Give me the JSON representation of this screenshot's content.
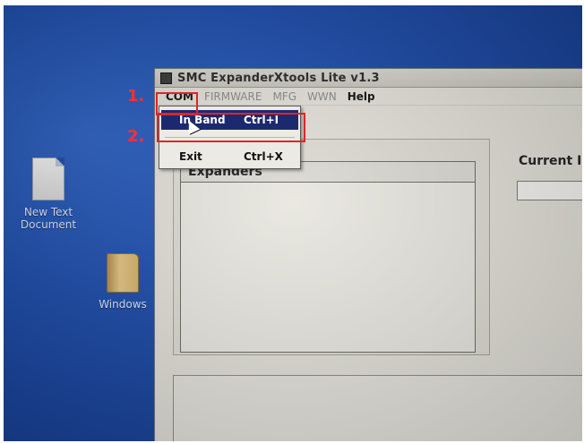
{
  "window": {
    "title": "SMC ExpanderXtools Lite v1.3"
  },
  "menu": [
    {
      "label": "COM"
    },
    {
      "label": "FIRMWARE"
    },
    {
      "label": "MFG"
    },
    {
      "label": "WWN"
    },
    {
      "label": "Help"
    }
  ],
  "dropdown": {
    "items": [
      {
        "label": "In Band",
        "shortcut": "Ctrl+I"
      },
      {
        "label": "Exit",
        "shortcut": "Ctrl+X"
      }
    ]
  },
  "content": {
    "expanders_header": "Expanders",
    "current_label": "Current Int"
  },
  "desktop": {
    "icons": [
      {
        "label": "New Text Document",
        "icon": "text-document-icon"
      },
      {
        "label": "Windows",
        "icon": "folder-icon"
      }
    ]
  },
  "annotations": {
    "step1": "1.",
    "step2": "2."
  },
  "colors": {
    "highlight": "#1b2a6f",
    "annotation": "#e0242a",
    "desktop": "#1f4fae"
  }
}
